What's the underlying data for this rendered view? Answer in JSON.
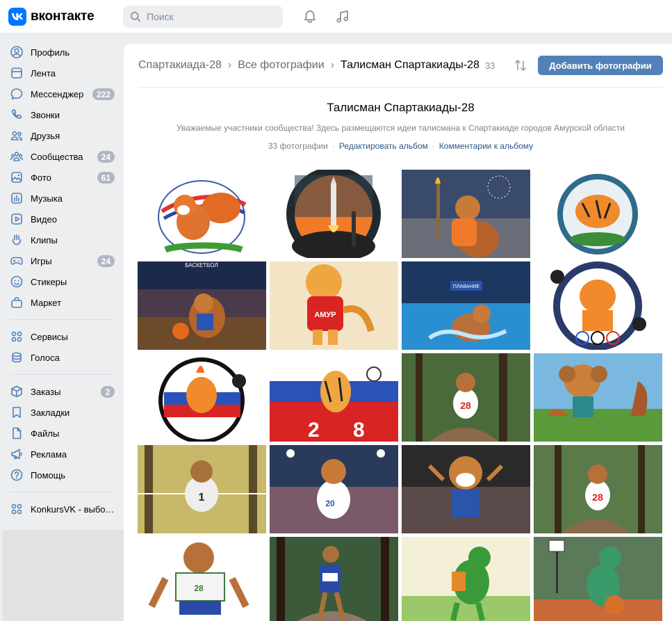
{
  "header": {
    "logo_letter": "VK",
    "logo_text": "вконтакте",
    "search_placeholder": "Поиск"
  },
  "sidebar": {
    "items": [
      {
        "label": "Профиль",
        "icon": "user-icon"
      },
      {
        "label": "Лента",
        "icon": "news-icon"
      },
      {
        "label": "Мессенджер",
        "icon": "message-icon",
        "badge": "222"
      },
      {
        "label": "Звонки",
        "icon": "phone-icon"
      },
      {
        "label": "Друзья",
        "icon": "friends-icon"
      },
      {
        "label": "Сообщества",
        "icon": "communities-icon",
        "badge": "24"
      },
      {
        "label": "Фото",
        "icon": "photo-icon",
        "badge": "61"
      },
      {
        "label": "Музыка",
        "icon": "music-icon"
      },
      {
        "label": "Видео",
        "icon": "video-icon"
      },
      {
        "label": "Клипы",
        "icon": "clips-icon"
      },
      {
        "label": "Игры",
        "icon": "games-icon",
        "badge": "24"
      },
      {
        "label": "Стикеры",
        "icon": "stickers-icon"
      },
      {
        "label": "Маркет",
        "icon": "market-icon"
      },
      {
        "label": "Сервисы",
        "icon": "services-icon"
      },
      {
        "label": "Голоса",
        "icon": "votes-icon"
      },
      {
        "label": "Заказы",
        "icon": "orders-icon",
        "badge": "2"
      },
      {
        "label": "Закладки",
        "icon": "bookmark-icon"
      },
      {
        "label": "Файлы",
        "icon": "file-icon"
      },
      {
        "label": "Реклама",
        "icon": "megaphone-icon"
      },
      {
        "label": "Помощь",
        "icon": "help-icon"
      },
      {
        "label": "KonkursVK - выбор...",
        "icon": "app-icon"
      }
    ]
  },
  "breadcrumbs": {
    "group": "Спартакиада-28",
    "all_photos": "Все фотографии",
    "current": "Талисман Спартакиады-28",
    "count": "33"
  },
  "buttons": {
    "add_photos": "Добавить фотографии"
  },
  "album": {
    "title": "Талисман Спартакиады-28",
    "description": "Уважаемые участники сообщества! Здесь размещаются идеи талисмана к Спартакиаде городов Амурской области",
    "photo_count": "33 фотографии",
    "edit_link": "Редактировать альбом",
    "comments_link": "Комментарии к альбому"
  },
  "colors": {
    "accent": "#5181b8",
    "link": "#2a5885",
    "logo": "#0077ff",
    "badge": "#aeb7c2"
  }
}
